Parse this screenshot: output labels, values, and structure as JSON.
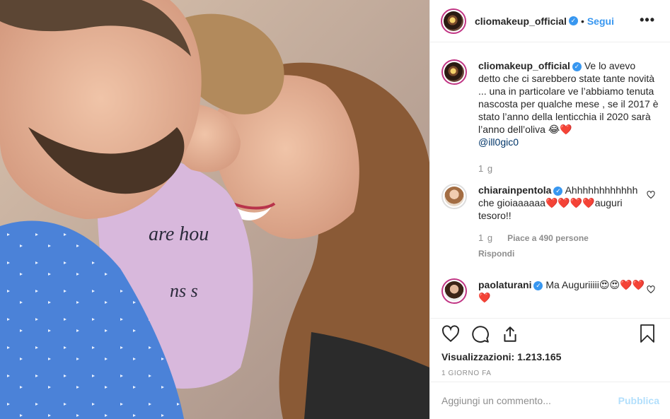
{
  "header": {
    "username": "cliomakeup_official",
    "verified_mark": "✓",
    "separator": "•",
    "follow_label": "Segui",
    "more_label": "•••"
  },
  "caption": {
    "username": "cliomakeup_official",
    "verified_mark": "✓",
    "text": "Ve lo avevo detto che ci sarebbero state tante novità ... una in particolare ve l’abbiamo tenuta nascosta per qualche mese , se il 2017 è stato l’anno della lenticchia il 2020 sarà l’anno dell’oliva 😂❤️",
    "mention": "@ill0gic0",
    "time": "1 g"
  },
  "comments": [
    {
      "username": "chiarainpentola",
      "verified_mark": "✓",
      "text": "Ahhhhhhhhhhhh che gioiaaaaaa❤️❤️❤️❤️auguri tesoro!!",
      "time": "1 g",
      "likes": "Piace a 490 persone",
      "reply": "Rispondi"
    },
    {
      "username": "paolaturani",
      "verified_mark": "✓",
      "text": "Ma Auguriiiii😍😍❤️❤️❤️"
    }
  ],
  "actions": {
    "views_label": "Visualizzazioni:",
    "views_count": "1.213.165",
    "posted": "1 GIORNO FA"
  },
  "add_comment": {
    "placeholder": "Aggiungi un commento...",
    "publish_label": "Pubblica"
  },
  "colors": {
    "link_blue": "#3897f0",
    "publish_disabled": "#b2dffc",
    "avatar_ring": "#c13584",
    "muted": "#8e8e8e"
  },
  "icons": [
    "more-icon",
    "verified-icon",
    "like-heart-icon",
    "comment-icon",
    "share-icon",
    "bookmark-icon",
    "comment-like-icon"
  ]
}
